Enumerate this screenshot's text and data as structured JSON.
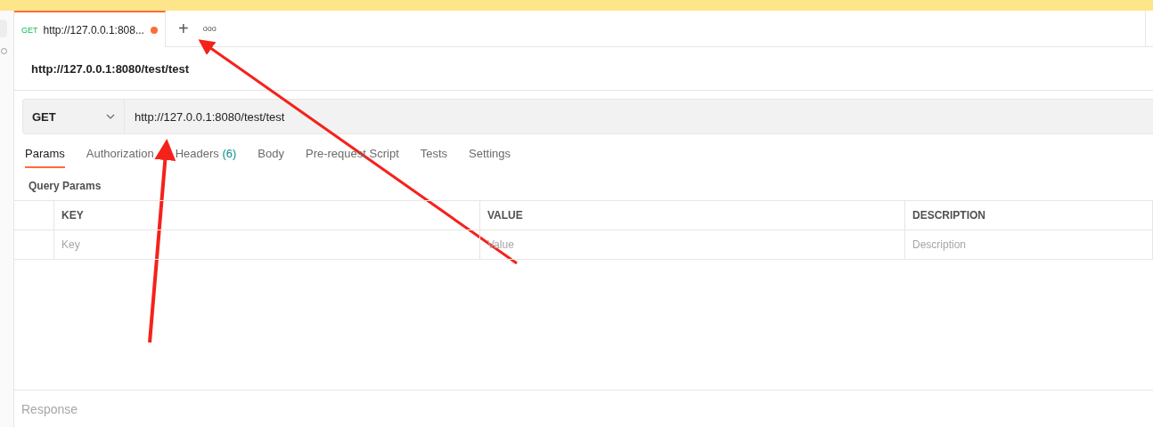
{
  "tabs": [
    {
      "method": "GET",
      "label": "http://127.0.0.1:808...",
      "unsaved": true,
      "selected": true
    }
  ],
  "new_tab_button": "+",
  "more_tabs_button": "ooo",
  "request_title": "http://127.0.0.1:8080/test/test",
  "request": {
    "method": "GET",
    "url": "http://127.0.0.1:8080/test/test"
  },
  "request_tabs": [
    {
      "label": "Params",
      "selected": true
    },
    {
      "label": "Authorization",
      "selected": false
    },
    {
      "label": "Headers",
      "count": "(6)",
      "selected": false
    },
    {
      "label": "Body",
      "selected": false
    },
    {
      "label": "Pre-request Script",
      "selected": false
    },
    {
      "label": "Tests",
      "selected": false
    },
    {
      "label": "Settings",
      "selected": false
    }
  ],
  "query_params": {
    "title": "Query Params",
    "columns": [
      "KEY",
      "VALUE",
      "DESCRIPTION"
    ],
    "placeholders": [
      "Key",
      "Value",
      "Description"
    ]
  },
  "response": {
    "title": "Response"
  }
}
